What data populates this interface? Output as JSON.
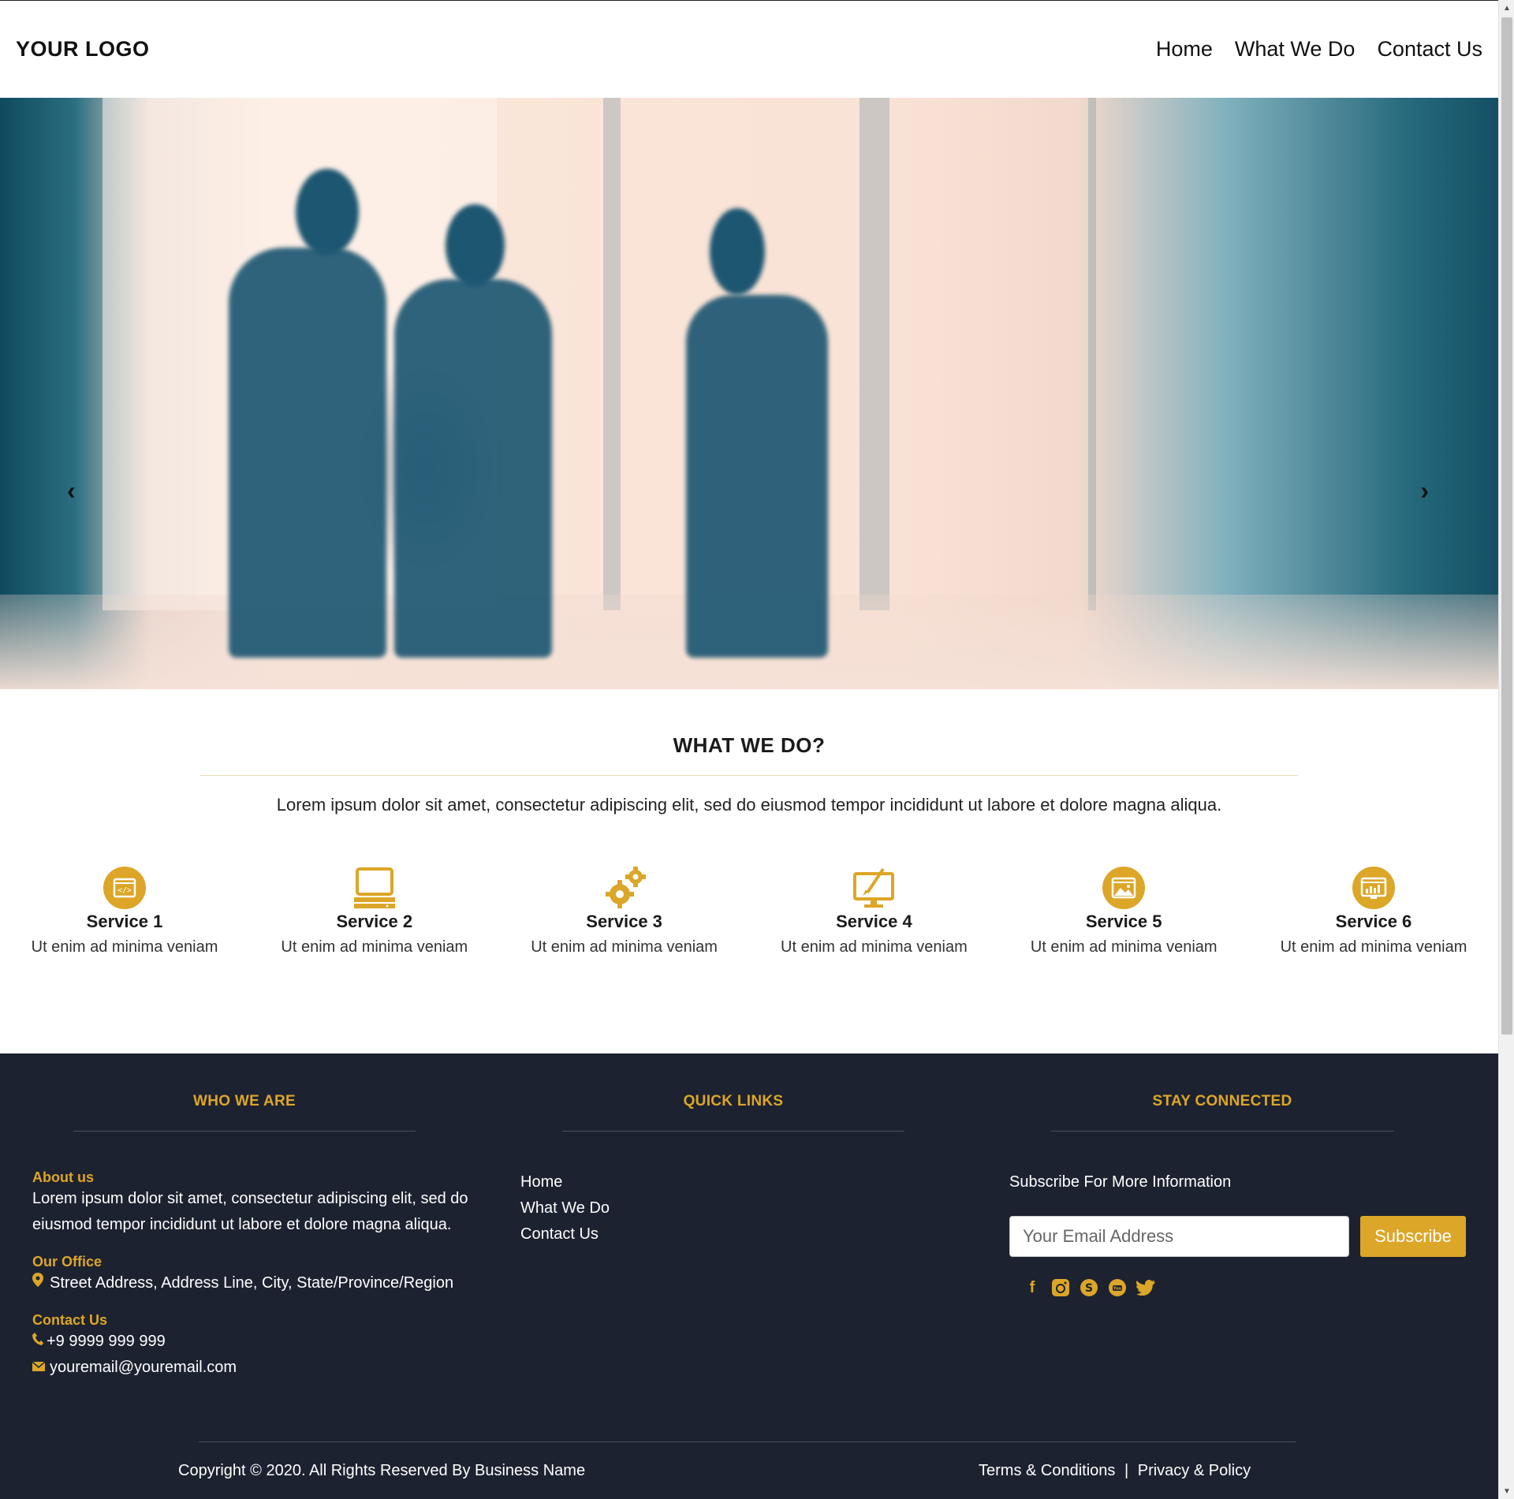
{
  "header": {
    "logo": "YOUR LOGO",
    "nav": [
      "Home",
      "What We Do",
      "Contact Us"
    ]
  },
  "hero": {
    "prev_arrow": "‹",
    "next_arrow": "›"
  },
  "services_section": {
    "title": "WHAT WE DO?",
    "description": "Lorem ipsum dolor sit amet, consectetur adipiscing elit, sed do eiusmod tempor incididunt ut labore et dolore magna aliqua.",
    "services": [
      {
        "title": "Service 1",
        "desc": "Ut enim ad minima veniam",
        "icon": "code-window-icon"
      },
      {
        "title": "Service 2",
        "desc": "Ut enim ad minima veniam",
        "icon": "laptop-icon"
      },
      {
        "title": "Service 3",
        "desc": "Ut enim ad minima veniam",
        "icon": "gears-icon"
      },
      {
        "title": "Service 4",
        "desc": "Ut enim ad minima veniam",
        "icon": "monitor-pen-icon"
      },
      {
        "title": "Service 5",
        "desc": "Ut enim ad minima veniam",
        "icon": "image-window-icon"
      },
      {
        "title": "Service 6",
        "desc": "Ut enim ad minima veniam",
        "icon": "chart-window-icon"
      }
    ]
  },
  "footer": {
    "who_we_are": {
      "heading": "WHO WE ARE",
      "about_label": "About us",
      "about_text": "Lorem ipsum dolor sit amet, consectetur adipiscing elit, sed do eiusmod tempor incididunt ut labore et dolore magna aliqua.",
      "office_label": "Our Office",
      "office_address": "Street Address, Address Line, City, State/Province/Region",
      "contact_label": "Contact Us",
      "phone": "+9 9999 999 999",
      "email": "youremail@youremail.com"
    },
    "quick_links": {
      "heading": "QUICK LINKS",
      "links": [
        "Home",
        "What We Do",
        "Contact Us"
      ]
    },
    "stay_connected": {
      "heading": "STAY CONNECTED",
      "subscribe_text": "Subscribe For More Information",
      "email_placeholder": "Your Email Address",
      "subscribe_button": "Subscribe",
      "social": [
        "facebook-icon",
        "instagram-icon",
        "skype-icon",
        "youtube-icon",
        "twitter-icon"
      ]
    },
    "copyright": "Copyright © 2020. All Rights Reserved By Business Name",
    "terms": "Terms & Conditions",
    "separator": "|",
    "privacy": "Privacy & Policy"
  },
  "colors": {
    "accent": "#dca628",
    "footer_bg": "#1d2230"
  }
}
